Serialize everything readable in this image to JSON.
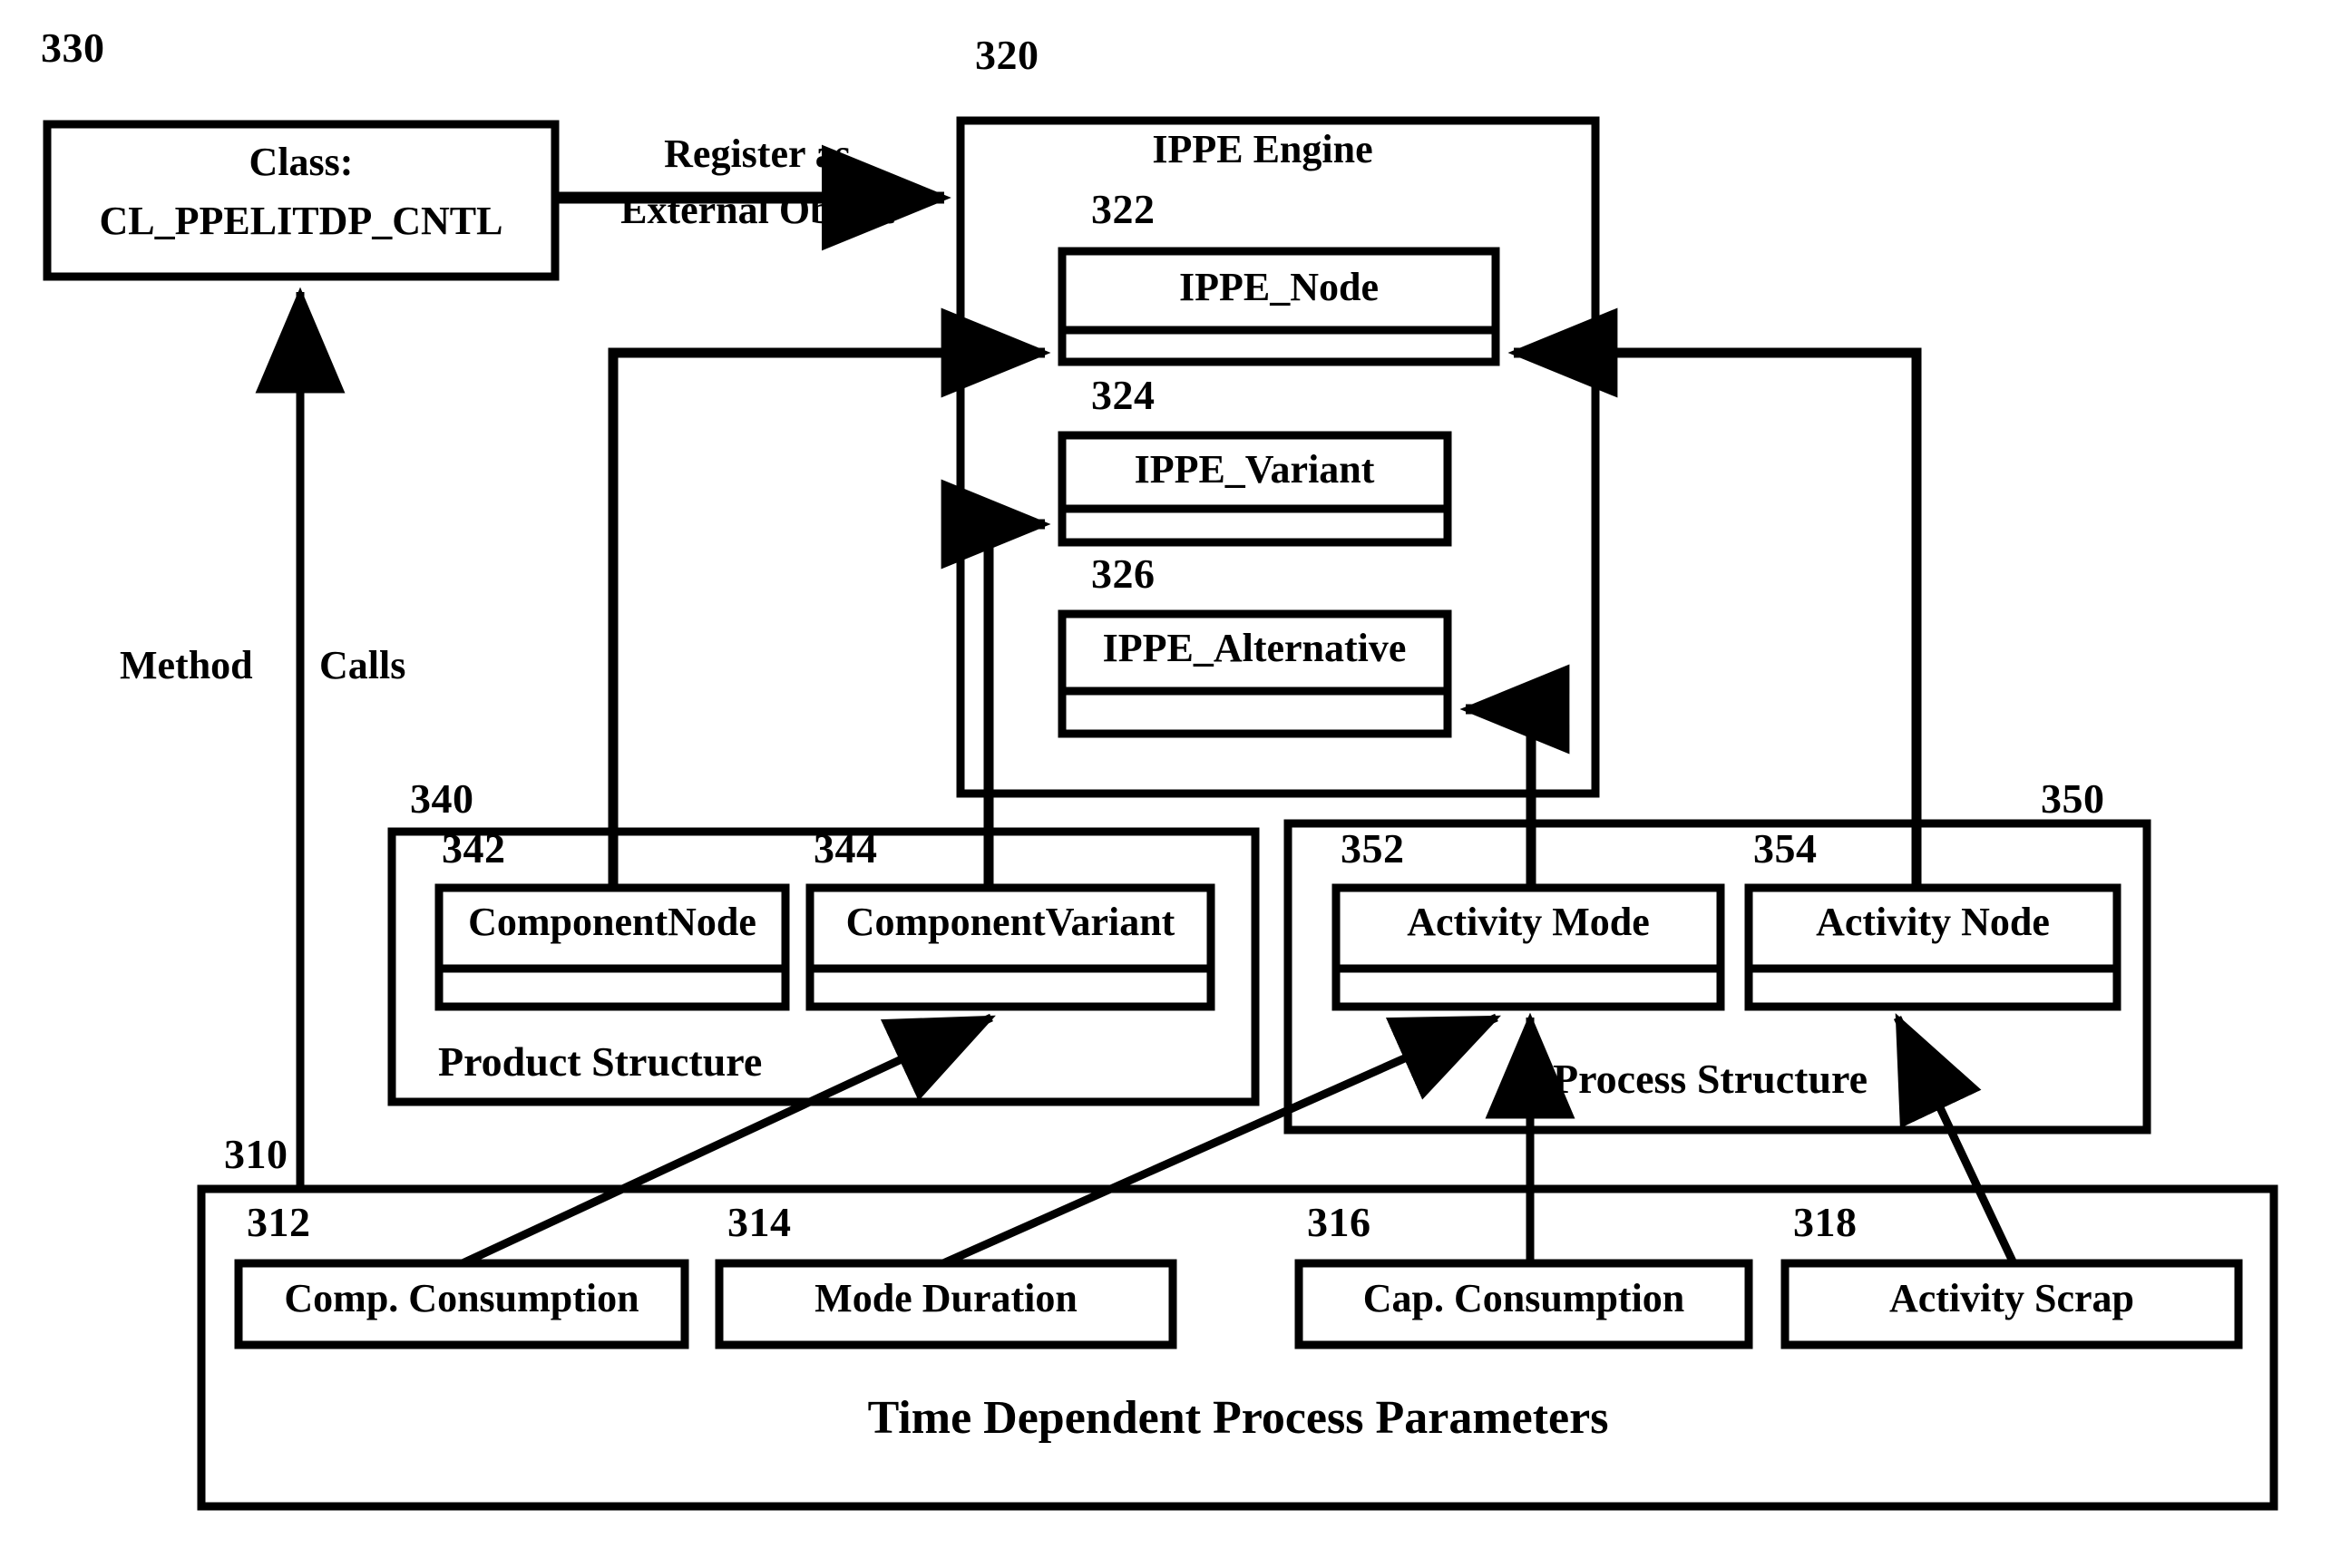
{
  "figure": {
    "type": "patent-block-diagram",
    "background": "#ffffff",
    "ink": "#000000"
  },
  "refs": {
    "r310": "310",
    "r312": "312",
    "r314": "314",
    "r316": "316",
    "r318": "318",
    "r320": "320",
    "r322": "322",
    "r324": "324",
    "r326": "326",
    "r330": "330",
    "r340": "340",
    "r342": "342",
    "r344": "344",
    "r350": "350",
    "r352": "352",
    "r354": "354"
  },
  "blocks": {
    "class_box": {
      "line1": "Class:",
      "line2": "CL_PPELITDP_CNTL"
    },
    "ippe_engine": {
      "title": "IPPE Engine",
      "children": [
        {
          "label": "IPPE_Node"
        },
        {
          "label": "IPPE_Variant"
        },
        {
          "label": "IPPE_Alternative"
        }
      ]
    },
    "product_structure": {
      "title": "Product Structure",
      "children": [
        {
          "label": "ComponentNode"
        },
        {
          "label": "ComponentVariant"
        }
      ]
    },
    "process_structure": {
      "title": "Process Structure",
      "children": [
        {
          "label": "Activity Mode"
        },
        {
          "label": "Activity Node"
        }
      ]
    },
    "time_dependent": {
      "title": "Time Dependent Process Parameters",
      "children": [
        {
          "label": "Comp. Consumption"
        },
        {
          "label": "Mode Duration"
        },
        {
          "label": "Cap. Consumption"
        },
        {
          "label": "Activity Scrap"
        }
      ]
    }
  },
  "connectors": {
    "register": {
      "line1": "Register as",
      "line2": "External Object"
    },
    "method_calls": {
      "word1": "Method",
      "word2": "Calls"
    }
  }
}
